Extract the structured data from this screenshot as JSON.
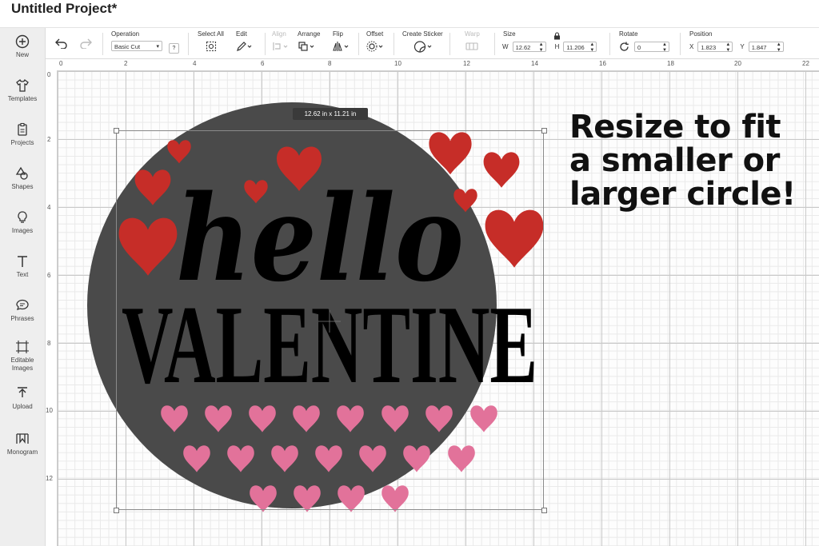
{
  "window": {
    "title": "Untitled Project*"
  },
  "sidebar": {
    "items": [
      {
        "label": "New",
        "icon": "plus-circle-icon"
      },
      {
        "label": "Templates",
        "icon": "shirt-icon"
      },
      {
        "label": "Projects",
        "icon": "clipboard-icon"
      },
      {
        "label": "Shapes",
        "icon": "shapes-icon"
      },
      {
        "label": "Images",
        "icon": "lightbulb-icon"
      },
      {
        "label": "Text",
        "icon": "text-t-icon"
      },
      {
        "label": "Phrases",
        "icon": "speech-bubble-icon"
      },
      {
        "label": "Editable Images",
        "icon": "editable-image-icon"
      },
      {
        "label": "Upload",
        "icon": "upload-icon"
      },
      {
        "label": "Monogram",
        "icon": "monogram-icon"
      }
    ]
  },
  "toolbar": {
    "operation_label": "Operation",
    "operation_value": "Basic Cut",
    "help": "?",
    "select_all_label": "Select All",
    "edit_label": "Edit",
    "align_label": "Align",
    "arrange_label": "Arrange",
    "flip_label": "Flip",
    "offset_label": "Offset",
    "create_sticker_label": "Create Sticker",
    "warp_label": "Warp",
    "size_label": "Size",
    "w_label": "W",
    "w_value": "12.62",
    "h_label": "H",
    "h_value": "11.206",
    "rotate_label": "Rotate",
    "rotate_value": "0",
    "position_label": "Position",
    "x_label": "X",
    "x_value": "1.823",
    "y_label": "Y",
    "y_value": "1.847"
  },
  "ruler": {
    "top": [
      "0",
      "2",
      "4",
      "6",
      "8",
      "10",
      "12",
      "14",
      "16",
      "18",
      "20",
      "22"
    ],
    "left": [
      "0",
      "2",
      "4",
      "6",
      "8",
      "10",
      "12"
    ]
  },
  "canvas": {
    "size_tooltip": "12.62  in x 11.21  in",
    "hello_text": "hello",
    "valentine_text": "VALENTINE"
  },
  "callout": {
    "line1": "Resize to fit",
    "line2": "a smaller or",
    "line3": "larger circle!"
  },
  "colors": {
    "circle": "#4a4a4a",
    "red_heart": "#c62d28",
    "pink_heart": "#e2729a",
    "text": "#000000"
  }
}
